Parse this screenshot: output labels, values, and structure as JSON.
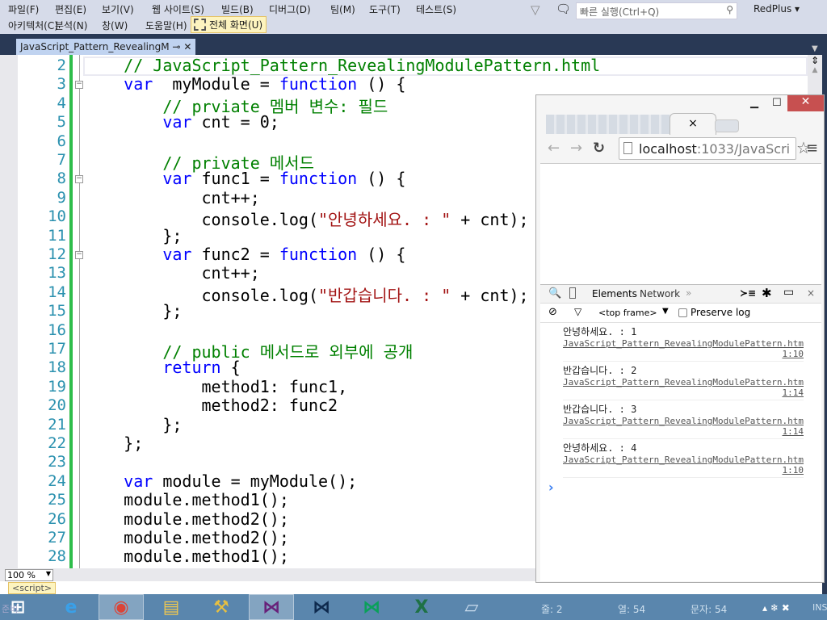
{
  "menu": {
    "row1": [
      "파일(F)",
      "편집(E)",
      "보기(V)",
      "웹 사이트(S)",
      "빌드(B)",
      "디버그(D)",
      "팀(M)",
      "도구(T)",
      "테스트(S)"
    ],
    "row2": [
      "아키텍처(C)",
      "분석(N)",
      "창(W)",
      "도움말(H)"
    ],
    "fullscreen": "전체 화면(U)",
    "quick_launch_placeholder": "빠른 실행(Ctrl+Q)",
    "user": "RedPlus"
  },
  "editor": {
    "tab_title": "JavaScript_Pattern_RevealingM",
    "zoom": "100 %",
    "breadcrumb": "<script>",
    "lines": [
      {
        "n": "2",
        "fold": false,
        "tokens": [
          [
            "cm",
            "    // JavaScript_Pattern_RevealingModulePattern.html"
          ]
        ]
      },
      {
        "n": "3",
        "fold": true,
        "tokens": [
          [
            "kw",
            "    var"
          ],
          [
            "",
            "  myModule = "
          ],
          [
            "kw",
            "function"
          ],
          [
            "",
            " () {"
          ]
        ]
      },
      {
        "n": "4",
        "fold": false,
        "tokens": [
          [
            "cm",
            "        // prviate 멤버 변수: 필드"
          ]
        ]
      },
      {
        "n": "5",
        "fold": false,
        "tokens": [
          [
            "kw",
            "        var"
          ],
          [
            "",
            " cnt = 0;"
          ]
        ]
      },
      {
        "n": "6",
        "fold": false,
        "tokens": []
      },
      {
        "n": "7",
        "fold": false,
        "tokens": [
          [
            "cm",
            "        // private 메서드"
          ]
        ]
      },
      {
        "n": "8",
        "fold": true,
        "tokens": [
          [
            "kw",
            "        var"
          ],
          [
            "",
            " func1 = "
          ],
          [
            "kw",
            "function"
          ],
          [
            "",
            " () {"
          ]
        ]
      },
      {
        "n": "9",
        "fold": false,
        "tokens": [
          [
            "",
            "            cnt++;"
          ]
        ]
      },
      {
        "n": "10",
        "fold": false,
        "tokens": [
          [
            "",
            "            console.log("
          ],
          [
            "str",
            "\"안녕하세요. : \""
          ],
          [
            "",
            " + cnt);"
          ]
        ]
      },
      {
        "n": "11",
        "fold": false,
        "tokens": [
          [
            "",
            "        };"
          ]
        ]
      },
      {
        "n": "12",
        "fold": true,
        "tokens": [
          [
            "kw",
            "        var"
          ],
          [
            "",
            " func2 = "
          ],
          [
            "kw",
            "function"
          ],
          [
            "",
            " () {"
          ]
        ]
      },
      {
        "n": "13",
        "fold": false,
        "tokens": [
          [
            "",
            "            cnt++;"
          ]
        ]
      },
      {
        "n": "14",
        "fold": false,
        "tokens": [
          [
            "",
            "            console.log("
          ],
          [
            "str",
            "\"반갑습니다. : \""
          ],
          [
            "",
            " + cnt);"
          ]
        ]
      },
      {
        "n": "15",
        "fold": false,
        "tokens": [
          [
            "",
            "        };"
          ]
        ]
      },
      {
        "n": "16",
        "fold": false,
        "tokens": []
      },
      {
        "n": "17",
        "fold": false,
        "tokens": [
          [
            "cm",
            "        // public 메서드로 외부에 공개"
          ]
        ]
      },
      {
        "n": "18",
        "fold": false,
        "tokens": [
          [
            "kw",
            "        return"
          ],
          [
            "",
            " {"
          ]
        ]
      },
      {
        "n": "19",
        "fold": false,
        "tokens": [
          [
            "",
            "            method1: func1,"
          ]
        ]
      },
      {
        "n": "20",
        "fold": false,
        "tokens": [
          [
            "",
            "            method2: func2"
          ]
        ]
      },
      {
        "n": "21",
        "fold": false,
        "tokens": [
          [
            "",
            "        };"
          ]
        ]
      },
      {
        "n": "22",
        "fold": false,
        "tokens": [
          [
            "",
            "    };"
          ]
        ]
      },
      {
        "n": "23",
        "fold": false,
        "tokens": []
      },
      {
        "n": "24",
        "fold": false,
        "tokens": [
          [
            "kw",
            "    var"
          ],
          [
            "",
            " module = myModule();"
          ]
        ]
      },
      {
        "n": "25",
        "fold": false,
        "tokens": [
          [
            "",
            "    module.method1();"
          ]
        ]
      },
      {
        "n": "26",
        "fold": false,
        "tokens": [
          [
            "",
            "    module.method2();"
          ]
        ]
      },
      {
        "n": "27",
        "fold": false,
        "tokens": [
          [
            "",
            "    module.method2();"
          ]
        ]
      },
      {
        "n": "28",
        "fold": false,
        "tokens": [
          [
            "",
            "    module.method1();"
          ]
        ]
      }
    ]
  },
  "status": {
    "line": "줄: 2",
    "col": "열: 54",
    "char": "문자: 54",
    "ready": "준비",
    "ins": "INS"
  },
  "browser": {
    "tab_close": "×",
    "url_host": "localhost",
    "url_rest": ":1033/JavaScri",
    "devtools": {
      "tabs": [
        "Elements",
        "Network"
      ],
      "more": "»",
      "frame": "<top frame>",
      "preserve_log": "Preserve log",
      "preserve_checked": false,
      "entries": [
        {
          "msg": "안녕하세요. : 1",
          "src": "JavaScript_Pattern_RevealingModulePattern.htm",
          "loc": "1:10"
        },
        {
          "msg": "반갑습니다. : 2",
          "src": "JavaScript_Pattern_RevealingModulePattern.htm",
          "loc": "1:14"
        },
        {
          "msg": "반갑습니다. : 3",
          "src": "JavaScript_Pattern_RevealingModulePattern.htm",
          "loc": "1:14"
        },
        {
          "msg": "안녕하세요. : 4",
          "src": "JavaScript_Pattern_RevealingModulePattern.htm",
          "loc": "1:10"
        }
      ],
      "prompt": "›"
    }
  },
  "taskbar": [
    "windows-start-icon",
    "internet-explorer-icon",
    "chrome-icon",
    "file-explorer-icon",
    "tools-icon",
    "visual-studio-icon",
    "visual-studio-dark-icon",
    "visual-studio-green-icon",
    "excel-icon",
    "notepad-icon"
  ],
  "colors": {
    "accent": "#68217a",
    "keyword": "#0000ff",
    "comment": "#008000",
    "string": "#a31515",
    "close": "#c75050"
  }
}
